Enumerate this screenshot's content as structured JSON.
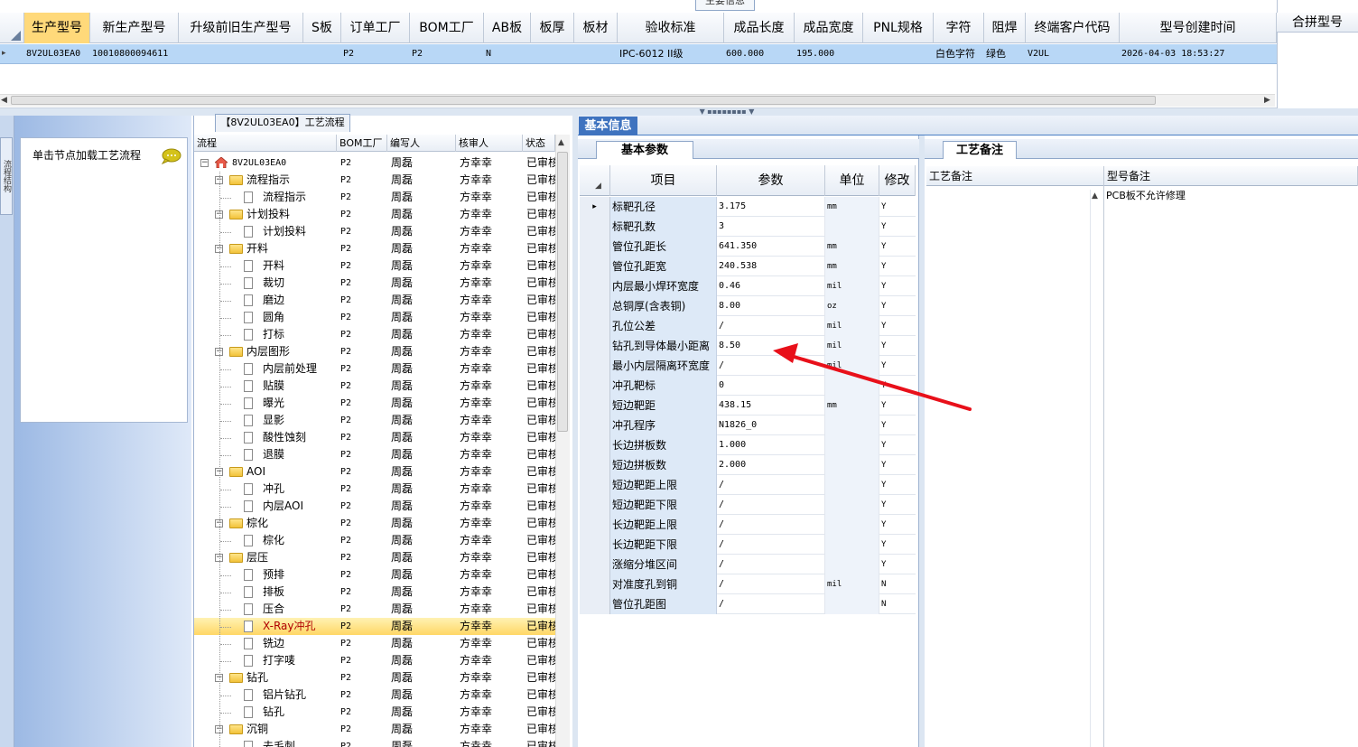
{
  "top_tab": "主要信息",
  "top_grid": {
    "headers": [
      "生产型号",
      "新生产型号",
      "升级前旧生产型号",
      "S板",
      "订单工厂",
      "BOM工厂",
      "AB板",
      "板厚",
      "板材",
      "验收标准",
      "成品长度",
      "成品宽度",
      "PNL规格",
      "字符",
      "阻焊",
      "终端客户代码",
      "型号创建时间"
    ],
    "row": [
      "8V2UL03EA0",
      "10010800094611",
      "",
      "",
      "P2",
      "P2",
      "N",
      "",
      "",
      "IPC-6012 II级",
      "600.000",
      "195.000",
      "",
      "白色字符",
      "绿色",
      "V2UL",
      "2026-04-03 18:53:27"
    ]
  },
  "merge_panel": {
    "header": "合拼型号"
  },
  "left_panel": {
    "sidebar_tab": "流程结构",
    "hint": "单击节点加载工艺流程"
  },
  "tree": {
    "tab": "【8V2UL03EA0】工艺流程",
    "headers": [
      "流程",
      "BOM工厂",
      "编写人",
      "核审人",
      "状态"
    ],
    "rows": [
      {
        "name": "8V2UL03EA0",
        "level": 0,
        "type": "root",
        "bom": "P2",
        "writer": "周磊",
        "reviewer": "方幸幸",
        "status": "已审核"
      },
      {
        "name": "流程指示",
        "level": 1,
        "type": "folder",
        "bom": "P2",
        "writer": "周磊",
        "reviewer": "方幸幸",
        "status": "已审核"
      },
      {
        "name": "流程指示",
        "level": 2,
        "type": "doc",
        "bom": "P2",
        "writer": "周磊",
        "reviewer": "方幸幸",
        "status": "已审核"
      },
      {
        "name": "计划投料",
        "level": 1,
        "type": "folder",
        "bom": "P2",
        "writer": "周磊",
        "reviewer": "方幸幸",
        "status": "已审核"
      },
      {
        "name": "计划投料",
        "level": 2,
        "type": "doc",
        "bom": "P2",
        "writer": "周磊",
        "reviewer": "方幸幸",
        "status": "已审核"
      },
      {
        "name": "开料",
        "level": 1,
        "type": "folder",
        "bom": "P2",
        "writer": "周磊",
        "reviewer": "方幸幸",
        "status": "已审核"
      },
      {
        "name": "开料",
        "level": 2,
        "type": "doc",
        "bom": "P2",
        "writer": "周磊",
        "reviewer": "方幸幸",
        "status": "已审核"
      },
      {
        "name": "裁切",
        "level": 2,
        "type": "doc",
        "bom": "P2",
        "writer": "周磊",
        "reviewer": "方幸幸",
        "status": "已审核"
      },
      {
        "name": "磨边",
        "level": 2,
        "type": "doc",
        "bom": "P2",
        "writer": "周磊",
        "reviewer": "方幸幸",
        "status": "已审核"
      },
      {
        "name": "圆角",
        "level": 2,
        "type": "doc",
        "bom": "P2",
        "writer": "周磊",
        "reviewer": "方幸幸",
        "status": "已审核"
      },
      {
        "name": "打标",
        "level": 2,
        "type": "doc",
        "bom": "P2",
        "writer": "周磊",
        "reviewer": "方幸幸",
        "status": "已审核"
      },
      {
        "name": "内层图形",
        "level": 1,
        "type": "folder",
        "bom": "P2",
        "writer": "周磊",
        "reviewer": "方幸幸",
        "status": "已审核"
      },
      {
        "name": "内层前处理",
        "level": 2,
        "type": "doc",
        "bom": "P2",
        "writer": "周磊",
        "reviewer": "方幸幸",
        "status": "已审核"
      },
      {
        "name": "贴膜",
        "level": 2,
        "type": "doc",
        "bom": "P2",
        "writer": "周磊",
        "reviewer": "方幸幸",
        "status": "已审核"
      },
      {
        "name": "曝光",
        "level": 2,
        "type": "doc",
        "bom": "P2",
        "writer": "周磊",
        "reviewer": "方幸幸",
        "status": "已审核"
      },
      {
        "name": "显影",
        "level": 2,
        "type": "doc",
        "bom": "P2",
        "writer": "周磊",
        "reviewer": "方幸幸",
        "status": "已审核"
      },
      {
        "name": "酸性蚀刻",
        "level": 2,
        "type": "doc",
        "bom": "P2",
        "writer": "周磊",
        "reviewer": "方幸幸",
        "status": "已审核"
      },
      {
        "name": "退膜",
        "level": 2,
        "type": "doc",
        "bom": "P2",
        "writer": "周磊",
        "reviewer": "方幸幸",
        "status": "已审核"
      },
      {
        "name": "AOI",
        "level": 1,
        "type": "folder",
        "bom": "P2",
        "writer": "周磊",
        "reviewer": "方幸幸",
        "status": "已审核"
      },
      {
        "name": "冲孔",
        "level": 2,
        "type": "doc",
        "bom": "P2",
        "writer": "周磊",
        "reviewer": "方幸幸",
        "status": "已审核"
      },
      {
        "name": "内层AOI",
        "level": 2,
        "type": "doc",
        "bom": "P2",
        "writer": "周磊",
        "reviewer": "方幸幸",
        "status": "已审核"
      },
      {
        "name": "棕化",
        "level": 1,
        "type": "folder",
        "bom": "P2",
        "writer": "周磊",
        "reviewer": "方幸幸",
        "status": "已审核"
      },
      {
        "name": "棕化",
        "level": 2,
        "type": "doc",
        "bom": "P2",
        "writer": "周磊",
        "reviewer": "方幸幸",
        "status": "已审核"
      },
      {
        "name": "层压",
        "level": 1,
        "type": "folder",
        "bom": "P2",
        "writer": "周磊",
        "reviewer": "方幸幸",
        "status": "已审核"
      },
      {
        "name": "预排",
        "level": 2,
        "type": "doc",
        "bom": "P2",
        "writer": "周磊",
        "reviewer": "方幸幸",
        "status": "已审核"
      },
      {
        "name": "排板",
        "level": 2,
        "type": "doc",
        "bom": "P2",
        "writer": "周磊",
        "reviewer": "方幸幸",
        "status": "已审核"
      },
      {
        "name": "压合",
        "level": 2,
        "type": "doc",
        "bom": "P2",
        "writer": "周磊",
        "reviewer": "方幸幸",
        "status": "已审核"
      },
      {
        "name": "X-Ray冲孔",
        "level": 2,
        "type": "doc",
        "bom": "P2",
        "writer": "周磊",
        "reviewer": "方幸幸",
        "status": "已审核",
        "selected": true
      },
      {
        "name": "铣边",
        "level": 2,
        "type": "doc",
        "bom": "P2",
        "writer": "周磊",
        "reviewer": "方幸幸",
        "status": "已审核"
      },
      {
        "name": "打字唛",
        "level": 2,
        "type": "doc",
        "bom": "P2",
        "writer": "周磊",
        "reviewer": "方幸幸",
        "status": "已审核"
      },
      {
        "name": "钻孔",
        "level": 1,
        "type": "folder",
        "bom": "P2",
        "writer": "周磊",
        "reviewer": "方幸幸",
        "status": "已审核"
      },
      {
        "name": "铝片钻孔",
        "level": 2,
        "type": "doc",
        "bom": "P2",
        "writer": "周磊",
        "reviewer": "方幸幸",
        "status": "已审核"
      },
      {
        "name": "钻孔",
        "level": 2,
        "type": "doc",
        "bom": "P2",
        "writer": "周磊",
        "reviewer": "方幸幸",
        "status": "已审核"
      },
      {
        "name": "沉铜",
        "level": 1,
        "type": "folder",
        "bom": "P2",
        "writer": "周磊",
        "reviewer": "方幸幸",
        "status": "已审核"
      },
      {
        "name": "去毛刺",
        "level": 2,
        "type": "doc",
        "bom": "P2",
        "writer": "周磊",
        "reviewer": "方幸幸",
        "status": "已审核"
      }
    ]
  },
  "basic_info": {
    "tab": "基本信息",
    "params_tab": "基本参数",
    "headers": [
      "项目",
      "参数",
      "单位",
      "修改"
    ],
    "rows": [
      {
        "item": "标靶孔径",
        "value": "3.175",
        "unit": "mm",
        "mod": "Y",
        "current": true
      },
      {
        "item": "标靶孔数",
        "value": "3",
        "unit": "",
        "mod": "Y"
      },
      {
        "item": "管位孔距长",
        "value": "641.350",
        "unit": "mm",
        "mod": "Y"
      },
      {
        "item": "管位孔距宽",
        "value": "240.538",
        "unit": "mm",
        "mod": "Y"
      },
      {
        "item": "内层最小焊环宽度",
        "value": "0.46",
        "unit": "mil",
        "mod": "Y"
      },
      {
        "item": "总铜厚(含表铜)",
        "value": "8.00",
        "unit": "oz",
        "mod": "Y"
      },
      {
        "item": "孔位公差",
        "value": "/",
        "unit": "mil",
        "mod": "Y"
      },
      {
        "item": "钻孔到导体最小距离",
        "value": "8.50",
        "unit": "mil",
        "mod": "Y"
      },
      {
        "item": "最小内层隔离环宽度",
        "value": "/",
        "unit": "mil",
        "mod": "Y"
      },
      {
        "item": "冲孔靶标",
        "value": "0",
        "unit": "",
        "mod": "Y"
      },
      {
        "item": "短边靶距",
        "value": "438.15",
        "unit": "mm",
        "mod": "Y"
      },
      {
        "item": "冲孔程序",
        "value": "N1826_0",
        "unit": "",
        "mod": "Y"
      },
      {
        "item": "长边拼板数",
        "value": "1.000",
        "unit": "",
        "mod": "Y"
      },
      {
        "item": "短边拼板数",
        "value": "2.000",
        "unit": "",
        "mod": "Y"
      },
      {
        "item": "短边靶距上限",
        "value": "/",
        "unit": "",
        "mod": "Y"
      },
      {
        "item": "短边靶距下限",
        "value": "/",
        "unit": "",
        "mod": "Y"
      },
      {
        "item": "长边靶距上限",
        "value": "/",
        "unit": "",
        "mod": "Y"
      },
      {
        "item": "长边靶距下限",
        "value": "/",
        "unit": "",
        "mod": "Y"
      },
      {
        "item": "涨缩分堆区间",
        "value": "/",
        "unit": "",
        "mod": "Y"
      },
      {
        "item": "对准度孔到铜",
        "value": "/",
        "unit": "mil",
        "mod": "N"
      },
      {
        "item": "管位孔距图",
        "value": "/",
        "unit": "",
        "mod": "N"
      }
    ]
  },
  "notes": {
    "tab": "工艺备注",
    "headers": [
      "工艺备注",
      "型号备注"
    ],
    "model_note": "PCB板不允许修理"
  },
  "colors": {
    "selection": "#b8d7f6",
    "tab_active": "#3f73bf",
    "highlight_row": "#ffd766",
    "annotation_arrow": "#e8101a"
  }
}
